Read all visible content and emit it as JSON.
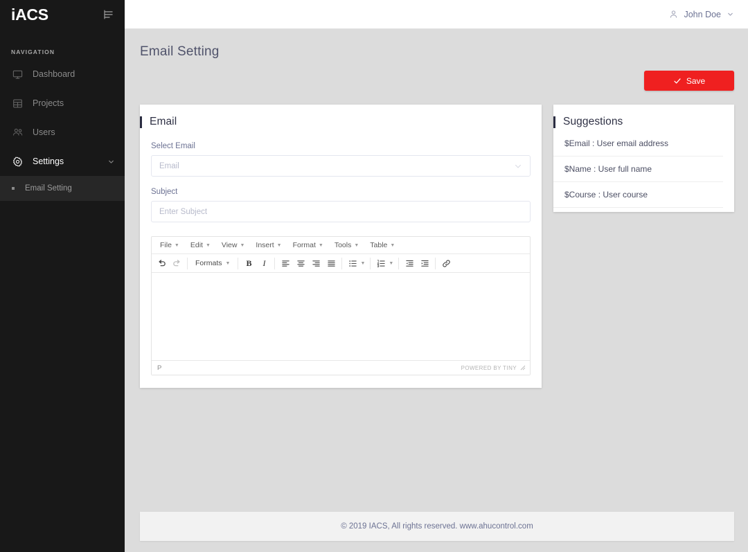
{
  "sidebar": {
    "brand": "iACS",
    "collapse_icon": "menu-collapse-icon",
    "nav_title": "NAVIGATION",
    "items": [
      {
        "label": "Dashboard",
        "icon": "monitor-icon",
        "active": false
      },
      {
        "label": "Projects",
        "icon": "grid-icon",
        "active": false
      },
      {
        "label": "Users",
        "icon": "users-icon",
        "active": false
      },
      {
        "label": "Settings",
        "icon": "gear-icon",
        "active": true,
        "expanded": true
      }
    ],
    "sub_items": [
      {
        "label": "Email Setting",
        "active": true
      }
    ]
  },
  "topbar": {
    "user_name": "John Doe",
    "user_icon": "person-icon",
    "chevron_icon": "chevron-down-icon"
  },
  "page": {
    "title": "Email Setting"
  },
  "toolbar": {
    "save_label": "Save",
    "save_icon": "check-icon",
    "save_color": "#ef2020"
  },
  "email_card": {
    "title": "Email",
    "select_email_label": "Select Email",
    "select_email_placeholder": "Email",
    "select_email_value": "",
    "subject_label": "Subject",
    "subject_placeholder": "Enter Subject",
    "subject_value": "",
    "editor": {
      "menus": [
        "File",
        "Edit",
        "View",
        "Insert",
        "Format",
        "Tools",
        "Table"
      ],
      "formats_label": "Formats",
      "buttons": [
        "undo-icon",
        "redo-icon",
        "bold-icon",
        "italic-icon",
        "align-left-icon",
        "align-center-icon",
        "align-right-icon",
        "align-justify-icon",
        "bullet-list-icon",
        "numbered-list-icon",
        "outdent-icon",
        "indent-icon",
        "link-icon"
      ],
      "body_content": "",
      "status_path": "P",
      "status_brand": "POWERED BY TINY"
    }
  },
  "suggestions_card": {
    "title": "Suggestions",
    "items": [
      "$Email : User email address",
      "$Name : User full name",
      "$Course : User course"
    ]
  },
  "footer": {
    "text": "© 2019 IACS,  All rights reserved. www.ahucontrol.com"
  }
}
